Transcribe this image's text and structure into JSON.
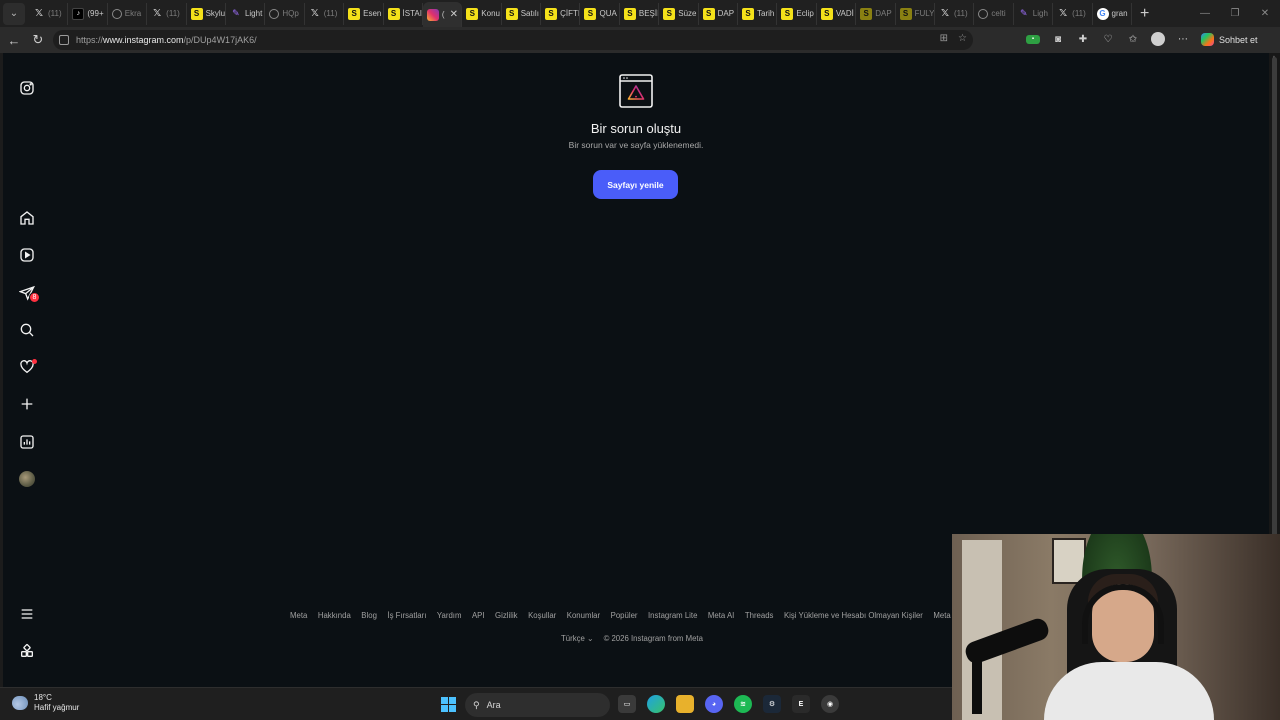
{
  "browser": {
    "tabs": [
      {
        "favicon": "x",
        "label": "(11)",
        "dim": true
      },
      {
        "favicon": "tiktok",
        "label": "(99+",
        "dim": false
      },
      {
        "favicon": "globe",
        "label": "Ekra",
        "dim": true
      },
      {
        "favicon": "x",
        "label": "(11)",
        "dim": true
      },
      {
        "favicon": "s",
        "label": "Skylu",
        "dim": false
      },
      {
        "favicon": "feather",
        "label": "Light",
        "dim": false
      },
      {
        "favicon": "globe",
        "label": "HQp",
        "dim": true
      },
      {
        "favicon": "x",
        "label": "(11)",
        "dim": true
      },
      {
        "favicon": "s",
        "label": "Esen",
        "dim": false
      },
      {
        "favicon": "s",
        "label": "İSTAI",
        "dim": false
      },
      {
        "favicon": "instagram",
        "label": "(",
        "dim": false,
        "active": true
      },
      {
        "favicon": "s",
        "label": "Konu",
        "dim": false
      },
      {
        "favicon": "s",
        "label": "Satılı",
        "dim": false
      },
      {
        "favicon": "s",
        "label": "ÇİFTI",
        "dim": false
      },
      {
        "favicon": "s",
        "label": "QUA",
        "dim": false
      },
      {
        "favicon": "s",
        "label": "BEŞİI",
        "dim": false
      },
      {
        "favicon": "s",
        "label": "Süze",
        "dim": false
      },
      {
        "favicon": "s",
        "label": "DAP",
        "dim": false
      },
      {
        "favicon": "s",
        "label": "Tarih",
        "dim": false
      },
      {
        "favicon": "s",
        "label": "Eclip",
        "dim": false
      },
      {
        "favicon": "s",
        "label": "VADİ",
        "dim": false
      },
      {
        "favicon": "s",
        "label": "DAP",
        "dim": true
      },
      {
        "favicon": "s",
        "label": "FULY",
        "dim": true
      },
      {
        "favicon": "x",
        "label": "(11)",
        "dim": true
      },
      {
        "favicon": "globe",
        "label": "celti",
        "dim": true
      },
      {
        "favicon": "feather",
        "label": "Ligh",
        "dim": true
      },
      {
        "favicon": "x",
        "label": "(11)",
        "dim": true
      },
      {
        "favicon": "google",
        "label": "gran",
        "dim": false
      }
    ],
    "new_tab": "+",
    "url_prefix": "https://",
    "url_host": "www.instagram.com",
    "url_path": "/p/DUp4W17jAK6/",
    "copilot_label": "Sohbet et"
  },
  "error": {
    "title": "Bir sorun oluştu",
    "subtitle": "Bir sorun var ve sayfa yüklenemedi.",
    "button": "Sayfayı yenile"
  },
  "sidebar": {
    "messages_badge": "8"
  },
  "footer": {
    "links": [
      "Meta",
      "Hakkında",
      "Blog",
      "İş Fırsatları",
      "Yardım",
      "API",
      "Gizlilik",
      "Koşullar",
      "Konumlar",
      "Popüler",
      "Instagram Lite",
      "Meta AI",
      "Threads",
      "Kişi Yükleme ve Hesabı Olmayan Kişiler",
      "Meta"
    ],
    "language": "Türkçe",
    "copyright": "© 2026 Instagram from Meta"
  },
  "taskbar": {
    "temperature": "18°C",
    "weather": "Hafif yağmur",
    "search_placeholder": "Ara"
  },
  "colors": {
    "page_bg": "#0b1014",
    "primary_button": "#4a5df9",
    "notification": "#ff3040"
  }
}
